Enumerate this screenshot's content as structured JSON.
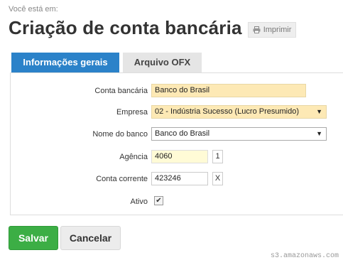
{
  "header": {
    "breadcrumb": "Você está em:",
    "title": "Criação de conta bancária",
    "print_label": "Imprimir"
  },
  "tabs": [
    {
      "label": "Informações gerais",
      "active": true
    },
    {
      "label": "Arquivo OFX",
      "active": false
    }
  ],
  "form": {
    "conta_bancaria": {
      "label": "Conta bancária",
      "value": "Banco do Brasil"
    },
    "empresa": {
      "label": "Empresa",
      "value": "02 - Indústria Sucesso (Lucro Presumido)"
    },
    "nome_banco": {
      "label": "Nome do banco",
      "value": "Banco do Brasil"
    },
    "agencia": {
      "label": "Agência",
      "value": "4060",
      "digit": "1"
    },
    "conta_corrente": {
      "label": "Conta corrente",
      "value": "423246",
      "digit": "X"
    },
    "ativo": {
      "label": "Ativo",
      "checked": true
    }
  },
  "actions": {
    "save_label": "Salvar",
    "cancel_label": "Cancelar"
  },
  "watermark": "s3.amazonaws.com",
  "colors": {
    "tab_active": "#2b82c9",
    "save_button": "#3cae45",
    "field_highlight": "#fde9b5"
  }
}
